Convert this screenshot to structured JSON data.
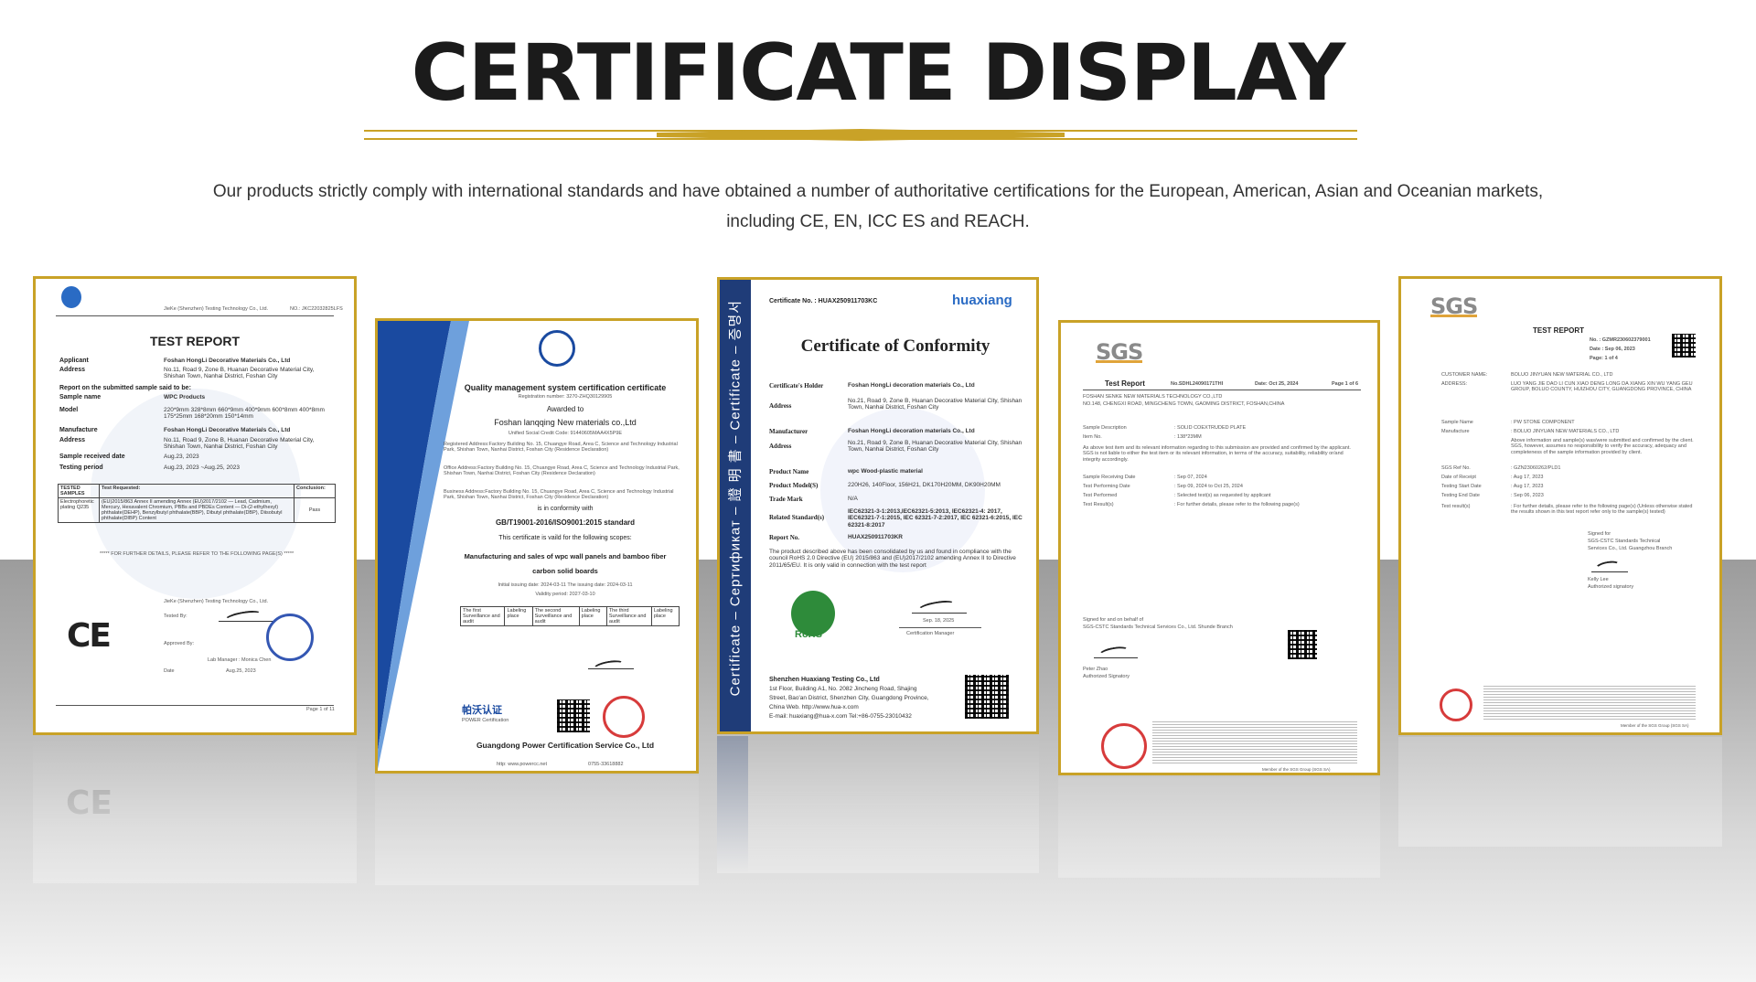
{
  "header": {
    "title": "CERTIFICATE DISPLAY",
    "intro_line1": "Our products strictly comply with international standards and have obtained a number of authoritative certifications for the European, American, Asian and Oceanian markets,",
    "intro_line2": "including CE, EN, ICC ES and REACH."
  },
  "colors": {
    "frame_gold": "#c9a227",
    "title": "#1b1b1b",
    "blue_band": "#1f3c78"
  },
  "cert1": {
    "lab": "JieKe (Shenzhen) Testing Technology Co., Ltd.",
    "report_no": "NO.: JKC22032825LFS",
    "title": "TEST REPORT",
    "applicant_label": "Applicant",
    "applicant": "Foshan HongLi Decorative Materials Co., Ltd",
    "address_label": "Address",
    "address": "No.11, Road 9, Zone B, Huanan Decorative Material City, Shishan Town, Nanhai District, Foshan City",
    "intro": "Report on the submitted sample said to be:",
    "sample_label": "Sample name",
    "sample": "WPC Products",
    "model_label": "Model",
    "model": "220*9mm 328*8mm 660*9mm 400*9mm 600*8mm 400*8mm 175*25mm 168*20mm 150*14mm",
    "mfr_label": "Manufacture",
    "mfr": "Foshan HongLi Decorative Materials Co., Ltd",
    "received_label": "Sample received date",
    "received": "Aug.23, 2023",
    "period_label": "Testing period",
    "period": "Aug.23, 2023 ~Aug.25, 2023",
    "table": {
      "h1": "TESTED SAMPLES",
      "h2": "Test Requested:",
      "h3": "Conclusion:",
      "r1c1": "Electrophoretic plating Q235",
      "r1c2": "(EU)2015/863 Annex II amending Annex (EU)2017/2102 — Lead, Cadmium, Mercury, Hexavalent Chromium, PBBs and PBDEs Content — Di-(2-ethylhexyl) phthalate(DEHP), Benzylbutyl phthalate(BBP), Dibutyl phthalate(DBP), Diisobutyl phthalate(DIBP) Content",
      "r1c3": "Pass"
    },
    "footer_note": "***** FOR FURTHER DETAILS, PLEASE REFER TO THE FOLLOWING PAGE(S) *****",
    "signer_co": "JieKe (Shenzhen) Testing Technology Co., Ltd.",
    "tested_by": "Tested By:",
    "approved_by": "Approved By:",
    "lab_manager": "Lab Manager : Monica Chen",
    "date_label": "Date",
    "date": "Aug.25, 2023",
    "ce": "CE",
    "page": "Page 1 of 11"
  },
  "cert2": {
    "title": "Quality management system certification certificate",
    "reg_no": "Registration number: 3270-ZHQ30129905",
    "awarded": "Awarded to",
    "company": "Foshan lanqqing New materials co.,Ltd",
    "credit": "Unified Social Credit Code: 91440605MAA4X5P9E",
    "reg_addr": "Registered Address:Factory Building No. 15, Chuangye Road, Area C, Science and Technology Industrial Park, Shishan Town, Nanhai District, Foshan City (Residence Declaration)",
    "office_addr": "Office Address:Factory Building No. 15, Chuangye Road, Area C, Science and Technology Industrial Park, Shishan Town, Nanhai District, Foshan City (Residence Declaration)",
    "biz_addr": "Business Address:Factory Building No. 15, Chuangye Road, Area C, Science and Technology Industrial Park, Shishan Town, Nanhai District, Foshan City (Residence Declaration)",
    "conformity": "is in conformity with",
    "standard": "GB/T19001-2016/ISO9001:2015 standard",
    "valid_for": "This certificate is vaild for the following scopes:",
    "scope1": "Manufacturing and sales of wpc wall panels and bamboo fiber",
    "scope2": "carbon solid boards",
    "issue": "Initial issuing date: 2024-03-11    The issuing date: 2024-03-11",
    "validity": "Validity period: 2027-03-10",
    "box1": "The first Surveillance and audit",
    "box2": "The second Surveillance and audit",
    "box3": "The third Surveillance and audit",
    "labeling": "Labeling place",
    "footer": "Guangdong Power Certification Service Co., Ltd",
    "brand": "帕沃认证",
    "brand_en": "POWER Certification",
    "website": "http: www.powercc.net",
    "phone": "0755-33618882"
  },
  "cert3": {
    "band_text": "Certificate – Сертификат – 證 明 書 – Certificate – 증명서",
    "cert_no": "Certificate No. : HUAX250911703KC",
    "logo": "huaxiang",
    "title": "Certificate of Conformity",
    "holder_label": "Certificate's Holder",
    "holder": "Foshan HongLi decoration materials Co., Ltd",
    "address_label": "Address",
    "address": "No.21, Road 9, Zone B, Huanan Decorative Material City, Shishan Town, Nanhai District, Foshan City",
    "mfr_label": "Manufacturer",
    "mfr": "Foshan HongLi decoration materials Co., Ltd",
    "mfr_addr_label": "Address",
    "mfr_addr": "No.21, Road 9, Zone B, Huanan Decorative Material City, Shishan Town, Nanhai District, Foshan City",
    "product_label": "Product Name",
    "product": "wpc Wood-plastic material",
    "model_label": "Product Model(S)",
    "model": "220H26, 140Floor, 156H21, DK170H20MM, DK90H20MM",
    "trademark_label": "Trade Mark",
    "trademark": "N/A",
    "std_label": "Related Standard(s)",
    "std": "IEC62321-3-1:2013,IEC62321-5:2013, IEC62321-4: 2017, IEC62321-7-1:2015, IEC 62321-7-2:2017, IEC 62321-6:2015, IEC 62321-8:2017",
    "report_label": "Report No.",
    "report": "HUAX250911703KR",
    "statement": "The product described above has been consolidated by us and found in compliance with the council RoHS 2.0 Directive (EU) 2015/863 and (EU)2017/2102 amending Annex II to Directive 2011/65/EU. It is only valid in connection with the test report",
    "date": "Sep. 18, 2025",
    "manager": "Certification Manager",
    "rohs": "RoHS",
    "issuer": "Shenzhen Huaxiang Testing Co., Ltd",
    "issuer_addr1": "1st Floor, Building A1, No. 2082 Jincheng Road, Shajing",
    "issuer_addr2": "Street, Bao'an District, Shenzhen City, Guangdong Province,",
    "issuer_web": "China                    Web. http://www.hua-x.com",
    "issuer_mail": "E-mail: huaxiang@hua-x.com    Tel:+86-0755-23010432"
  },
  "cert4": {
    "logo": "SGS",
    "title": "Test Report",
    "no": "No.SDHL24090171THI",
    "date": "Date: Oct 25, 2024",
    "page": "Page 1 of 6",
    "client": "FOSHAN SENKE NEW MATERIALS TECHNOLOGY CO.,LTD",
    "client_addr": "NO.148, CHENGXI ROAD, MINGCHENG TOWN, GAOMING DISTRICT, FOSHAN,CHINA",
    "desc_label": "Sample Description",
    "desc": ": SOLID COEXTRUDED PLATE",
    "item_label": "Item No.",
    "item": ": 138*23MM",
    "disclaimer": "As above test item and its relevant information regarding to this submission are provided and confirmed by the applicant. SGS is not liable to either the test item or its relevant information, in terms of the accuracy, suitability, reliability or/and integrity accordingly.",
    "recv_label": "Sample Receiving Date",
    "recv": ": Sep 07, 2024",
    "perf_label": "Test Performing Date",
    "perf": ": Sep 09, 2024 to Oct 25, 2024",
    "tp_label": "Test Performed",
    "tp": ": Selected test(s) as requested by applicant",
    "res_label": "Test Result(s)",
    "res": ": For further details, please refer to the following page(s)",
    "signed": "Signed for and on behalf of",
    "signed_co": "SGS-CSTC Standards Technical Services Co., Ltd. Shunde Branch",
    "signer": "Peter Zhao",
    "signer_title": "Authorized Signatory",
    "member": "Member of the SGS Group (SGS SA)"
  },
  "cert5": {
    "logo": "SGS",
    "title": "TEST REPORT",
    "no": "No.   : GZMR230602379001",
    "date": "Date :   Sep 06, 2023",
    "page": "Page:   1  of  4",
    "cust_label": "CUSTOMER NAME:",
    "cust": "BOLUO JINYUAN NEW MATERIAL CO., LTD",
    "addr_label": "ADDRESS:",
    "addr": "LUO YANG JIE DAO LI CUN XIAO DENG LONG DA XIANG XIN WU YANG GEU GROUP, BOLUO COUNTY, HUIZHOU CITY, GUANGDONG PROVINCE, CHINA",
    "sample_label": "Sample Name",
    "sample": ": PW STONE COMPONENT",
    "mfr_label": "Manufacture",
    "mfr": ": BOLUO JINYUAN NEW MATERIALS CO., LTD",
    "note": "Above information and sample(s) was/were submitted and confirmed by the client. SGS, however, assumes no responsibility to verify the accuracy, adequacy and completeness of the sample information provided by client.",
    "ref_label": "SGS Ref No.",
    "ref": ": GZN23060262/PLD1",
    "receipt_label": "Date of Receipt",
    "receipt": ": Aug 17, 2023",
    "start_label": "Testing Start Date",
    "start": ": Aug 17, 2023",
    "end_label": "Testing End Date",
    "end": ": Sep 06, 2023",
    "result_label": "Test result(s)",
    "result": ": For further details, please refer to the following page(s) (Unless otherwise stated the results shown in this test report refer only to the sample(s) tested)",
    "signed": "Signed for",
    "signed_co1": "SGS-CSTC Standards Technical",
    "signed_co2": "Services Co., Ltd. Guangzhou Branch",
    "signer": "Kelly Lee",
    "signer_title": "Authorized signatory",
    "member": "Member of the SGS Group (SGS SA)"
  }
}
